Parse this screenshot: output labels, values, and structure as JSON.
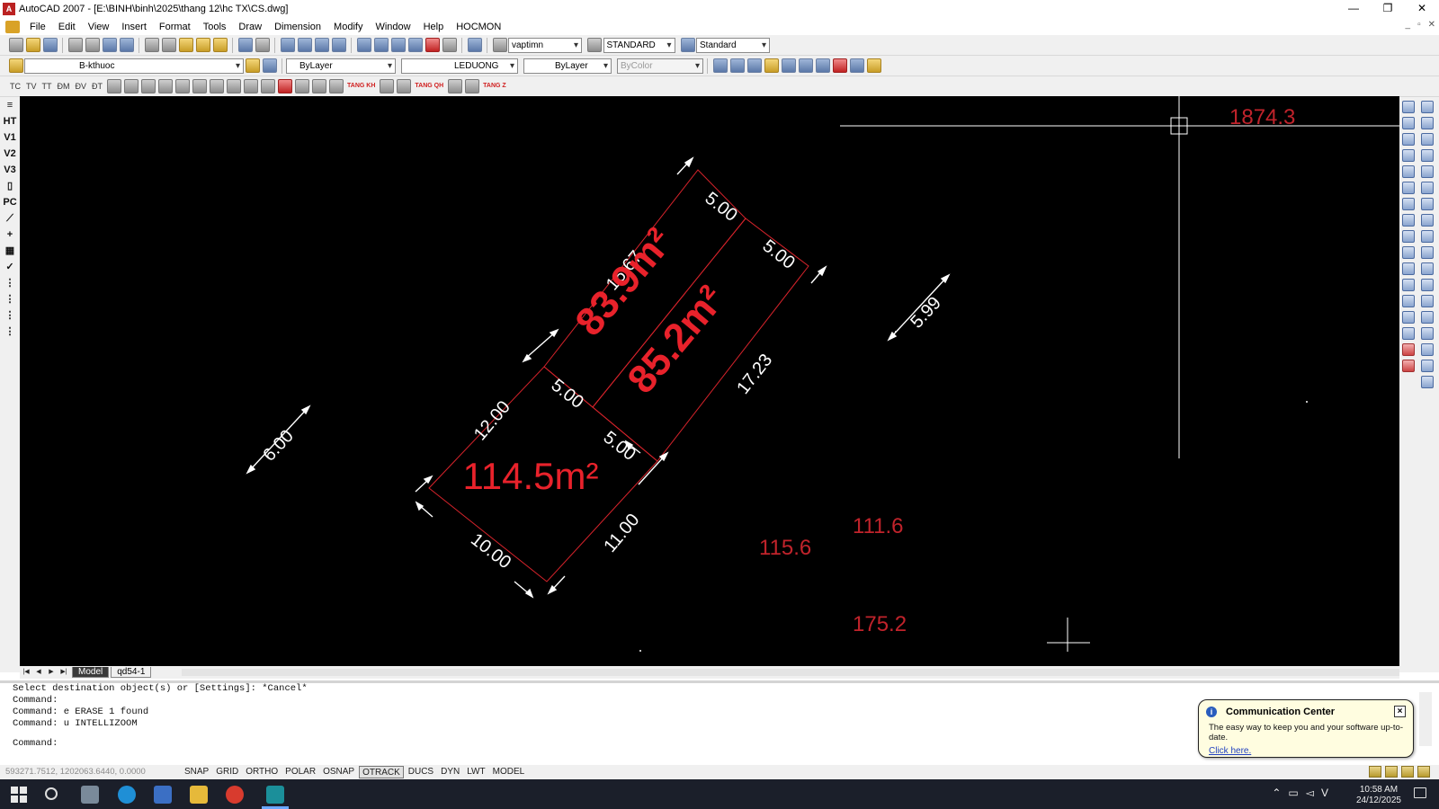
{
  "window": {
    "title": "AutoCAD 2007 - [E:\\BINH\\binh\\2025\\thang 12\\hc TX\\CS.dwg]",
    "app_icon": "autocad-logo",
    "controls": [
      "—",
      "❐",
      "✕"
    ]
  },
  "menubar": {
    "items": [
      "File",
      "Edit",
      "View",
      "Insert",
      "Format",
      "Tools",
      "Draw",
      "Dimension",
      "Modify",
      "Window",
      "Help",
      "HOCMON"
    ],
    "mdi_controls": [
      "_",
      "▫",
      "✕"
    ]
  },
  "toolbars": {
    "text_style": "vaptimn",
    "dim_style": "STANDARD",
    "table_style": "Standard",
    "layer": "B-kthuoc",
    "color": "ByLayer",
    "linetype": "LEDUONG",
    "lineweight": "ByLayer",
    "plot_style": "ByColor",
    "custom_text_buttons": [
      "TC",
      "TV",
      "TT",
      "ĐM",
      "ĐV",
      "ĐT"
    ],
    "custom_red_buttons": [
      "TANG KH",
      "TANG QH",
      "TANG Z"
    ]
  },
  "left_panel": {
    "items": [
      "HT",
      "V1",
      "V2",
      "V3",
      "PC"
    ]
  },
  "drawing": {
    "background": "#000000",
    "area_color": "#e8222b",
    "label_color": "#c0232b",
    "dim_color": "#ffffff",
    "areas": [
      "83.9m²",
      "85.2m²",
      "114.5m²"
    ],
    "dimensions": [
      "16.67",
      "5.00",
      "5.00",
      "12.00",
      "5.00",
      "5.00",
      "17.23",
      "11.00",
      "10.00",
      "6.00",
      "5.99"
    ],
    "point_labels": [
      "1874.3",
      "111.6",
      "115.6",
      "175.2"
    ]
  },
  "tabs": {
    "nav": [
      "|◀",
      "◀",
      "▶",
      "▶|"
    ],
    "layouts": [
      "Model",
      "qd54-1"
    ]
  },
  "command": {
    "lines": [
      "Select destination object(s) or [Settings]: *Cancel*",
      "Command:",
      "Command: e ERASE 1 found",
      "Command: u INTELLIZOOM"
    ],
    "prompt": "Command:"
  },
  "comm_center": {
    "title": "Communication Center",
    "body": "The easy way to keep you and your software up-to-date.",
    "link": "Click here."
  },
  "statusbar": {
    "coords": "593271.7512, 1202063.6440, 0.0000",
    "toggles": [
      {
        "label": "SNAP",
        "on": false
      },
      {
        "label": "GRID",
        "on": false
      },
      {
        "label": "ORTHO",
        "on": false
      },
      {
        "label": "POLAR",
        "on": false
      },
      {
        "label": "OSNAP",
        "on": false
      },
      {
        "label": "OTRACK",
        "on": true
      },
      {
        "label": "DUCS",
        "on": false
      },
      {
        "label": "DYN",
        "on": false
      },
      {
        "label": "LWT",
        "on": false
      },
      {
        "label": "MODEL",
        "on": false
      }
    ]
  },
  "taskbar": {
    "time": "10:58 AM",
    "date": "24/12/2025",
    "apps": [
      "start-icon",
      "search-icon",
      "task-view-icon",
      "edge-icon",
      "store-icon",
      "file-explorer-icon",
      "chrome-icon",
      "autocad-icon"
    ]
  }
}
